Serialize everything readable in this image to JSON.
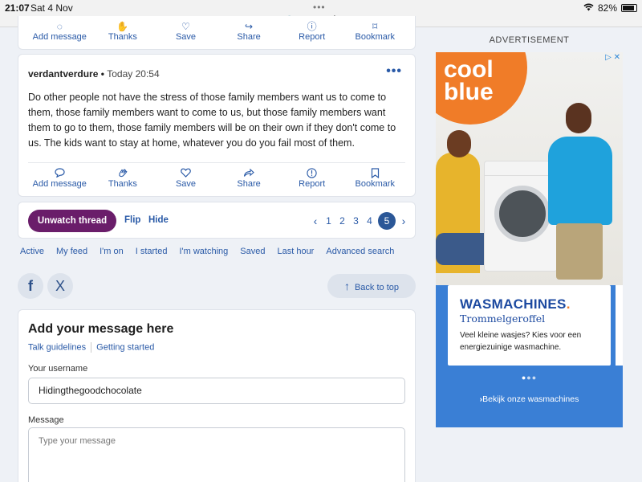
{
  "status_bar": {
    "time": "21:07",
    "date": "Sat 4 Nov",
    "url": "mumsnet.com",
    "battery": "82%"
  },
  "top_actions": [
    "Add message",
    "Thanks",
    "Save",
    "Share",
    "Report",
    "Bookmark"
  ],
  "post": {
    "author": "verdantverdure",
    "separator": " • ",
    "time": "Today 20:54",
    "body": "Do other people not have the stress of those family members want us to come to them, those family members want to come to us, but those family members want them to go to them, those family members will be on their own if they don't come to us. The kids want to stay at home, whatever you do you fail most of them.",
    "actions": [
      {
        "label": "Add message",
        "icon": "speech-bubble-icon"
      },
      {
        "label": "Thanks",
        "icon": "clap-hands-icon"
      },
      {
        "label": "Save",
        "icon": "heart-icon"
      },
      {
        "label": "Share",
        "icon": "share-arrow-icon"
      },
      {
        "label": "Report",
        "icon": "info-circle-icon"
      },
      {
        "label": "Bookmark",
        "icon": "bookmark-icon"
      }
    ]
  },
  "thread_bar": {
    "unwatch": "Unwatch thread",
    "flip": "Flip",
    "hide": "Hide",
    "pages": [
      "1",
      "2",
      "3",
      "4",
      "5"
    ],
    "current_page": "5",
    "colors": {
      "unwatch": "#6a1d6a",
      "active_page": "#2b5797"
    }
  },
  "quick_links": [
    "Active",
    "My feed",
    "I'm on",
    "I started",
    "I'm watching",
    "Saved",
    "Last hour",
    "Advanced search"
  ],
  "share": {
    "facebook": "f",
    "x": "X",
    "back_to_top": "Back to top"
  },
  "reply": {
    "title": "Add your message here",
    "links": [
      "Talk guidelines",
      "Getting started"
    ],
    "username_label": "Your username",
    "username_value": "Hidingthegoodchocolate",
    "message_label": "Message",
    "message_placeholder": "Type your message"
  },
  "advert": {
    "heading": "ADVERTISEMENT",
    "logo_line1": "cool",
    "logo_line2": "blue",
    "title": "WASMACHINES",
    "title_dot": ".",
    "subtitle": "Trommelgeroffel",
    "text": "Veel kleine wasjes? Kies voor een energiezuinige wasmachine.",
    "cta": "Bekijk onze wasmachines",
    "colors": {
      "brand_orange": "#f07c28",
      "ad_blue": "#3a7fd5"
    }
  }
}
